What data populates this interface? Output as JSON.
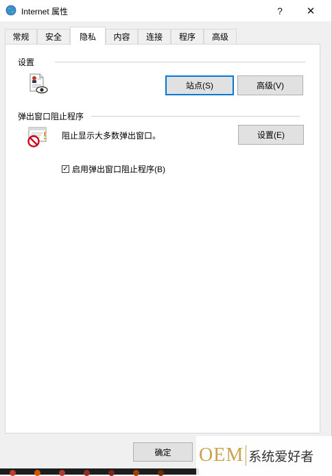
{
  "window": {
    "title": "Internet 属性",
    "help_glyph": "?",
    "close_glyph": "✕"
  },
  "tabs": [
    {
      "label": "常规"
    },
    {
      "label": "安全"
    },
    {
      "label": "隐私"
    },
    {
      "label": "内容"
    },
    {
      "label": "连接"
    },
    {
      "label": "程序"
    },
    {
      "label": "高级"
    }
  ],
  "active_tab": "隐私",
  "settings_group": {
    "label": "设置",
    "sites_button": "站点(S)",
    "advanced_button": "高级(V)"
  },
  "popup_group": {
    "label": "弹出窗口阻止程序",
    "description": "阻止显示大多数弹出窗口。",
    "settings_button": "设置(E)",
    "checkbox_label": "启用弹出窗口阻止程序(B)",
    "checkbox_checked": true,
    "check_glyph": "✓"
  },
  "footer": {
    "ok_button": "确定"
  },
  "watermark": {
    "brand": "OEM",
    "text": "系统爱好者"
  },
  "colors": {
    "accent": "#0078d7",
    "watermark_gold": "#c9a24a"
  }
}
